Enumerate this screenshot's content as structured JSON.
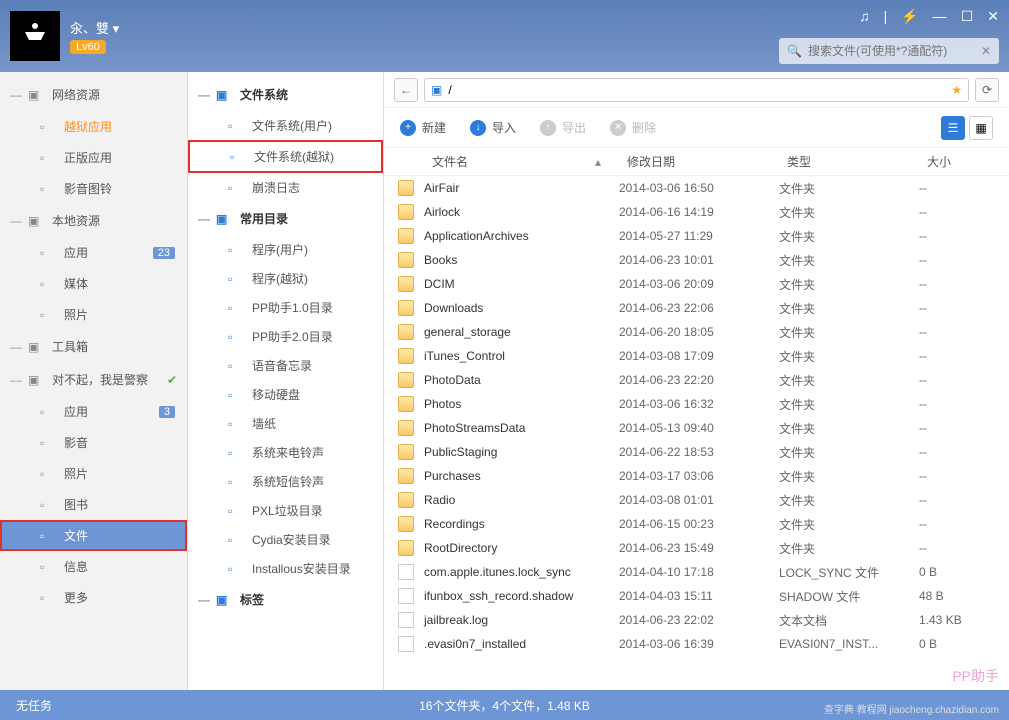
{
  "header": {
    "username": "汆、雙 ▾",
    "level": "Lv60",
    "search_placeholder": "搜索文件(可使用*?通配符)"
  },
  "sidebar_left": {
    "groups": [
      {
        "title": "网络资源",
        "items": [
          {
            "label": "越狱应用",
            "active": true
          },
          {
            "label": "正版应用"
          },
          {
            "label": "影音图铃"
          }
        ]
      },
      {
        "title": "本地资源",
        "items": [
          {
            "label": "应用",
            "badge": "23"
          },
          {
            "label": "媒体"
          },
          {
            "label": "照片"
          }
        ]
      },
      {
        "title": "工具箱",
        "items": []
      },
      {
        "title": "对不起，我是警察",
        "check": true,
        "items": [
          {
            "label": "应用",
            "badge": "3"
          },
          {
            "label": "影音"
          },
          {
            "label": "照片"
          },
          {
            "label": "图书"
          },
          {
            "label": "文件",
            "selected": true,
            "highlighted": true
          },
          {
            "label": "信息"
          },
          {
            "label": "更多"
          }
        ]
      }
    ]
  },
  "sidebar_mid": {
    "groups": [
      {
        "title": "文件系统",
        "items": [
          {
            "label": "文件系统(用户)"
          },
          {
            "label": "文件系统(越狱)",
            "highlighted": true
          },
          {
            "label": "崩溃日志"
          }
        ]
      },
      {
        "title": "常用目录",
        "items": [
          {
            "label": "程序(用户)"
          },
          {
            "label": "程序(越狱)"
          },
          {
            "label": "PP助手1.0目录"
          },
          {
            "label": "PP助手2.0目录"
          },
          {
            "label": "语音备忘录"
          },
          {
            "label": "移动硬盘"
          },
          {
            "label": "墙纸"
          },
          {
            "label": "系统来电铃声"
          },
          {
            "label": "系统短信铃声"
          },
          {
            "label": "PXL垃圾目录"
          },
          {
            "label": "Cydia安装目录"
          },
          {
            "label": "Installous安装目录"
          }
        ]
      },
      {
        "title": "标签",
        "items": []
      }
    ]
  },
  "pathbar": {
    "path": "/"
  },
  "toolbar": {
    "new": "新建",
    "import": "导入",
    "export": "导出",
    "delete": "删除"
  },
  "columns": {
    "name": "文件名",
    "date": "修改日期",
    "type": "类型",
    "size": "大小"
  },
  "files": [
    {
      "name": "AirFair",
      "date": "2014-03-06 16:50",
      "type": "文件夹",
      "size": "--",
      "folder": true
    },
    {
      "name": "Airlock",
      "date": "2014-06-16 14:19",
      "type": "文件夹",
      "size": "--",
      "folder": true
    },
    {
      "name": "ApplicationArchives",
      "date": "2014-05-27 11:29",
      "type": "文件夹",
      "size": "--",
      "folder": true
    },
    {
      "name": "Books",
      "date": "2014-06-23 10:01",
      "type": "文件夹",
      "size": "--",
      "folder": true
    },
    {
      "name": "DCIM",
      "date": "2014-03-06 20:09",
      "type": "文件夹",
      "size": "--",
      "folder": true
    },
    {
      "name": "Downloads",
      "date": "2014-06-23 22:06",
      "type": "文件夹",
      "size": "--",
      "folder": true
    },
    {
      "name": "general_storage",
      "date": "2014-06-20 18:05",
      "type": "文件夹",
      "size": "--",
      "folder": true
    },
    {
      "name": "iTunes_Control",
      "date": "2014-03-08 17:09",
      "type": "文件夹",
      "size": "--",
      "folder": true
    },
    {
      "name": "PhotoData",
      "date": "2014-06-23 22:20",
      "type": "文件夹",
      "size": "--",
      "folder": true
    },
    {
      "name": "Photos",
      "date": "2014-03-06 16:32",
      "type": "文件夹",
      "size": "--",
      "folder": true
    },
    {
      "name": "PhotoStreamsData",
      "date": "2014-05-13 09:40",
      "type": "文件夹",
      "size": "--",
      "folder": true
    },
    {
      "name": "PublicStaging",
      "date": "2014-06-22 18:53",
      "type": "文件夹",
      "size": "--",
      "folder": true
    },
    {
      "name": "Purchases",
      "date": "2014-03-17 03:06",
      "type": "文件夹",
      "size": "--",
      "folder": true
    },
    {
      "name": "Radio",
      "date": "2014-03-08 01:01",
      "type": "文件夹",
      "size": "--",
      "folder": true
    },
    {
      "name": "Recordings",
      "date": "2014-06-15 00:23",
      "type": "文件夹",
      "size": "--",
      "folder": true
    },
    {
      "name": "RootDirectory",
      "date": "2014-06-23 15:49",
      "type": "文件夹",
      "size": "--",
      "folder": true
    },
    {
      "name": "com.apple.itunes.lock_sync",
      "date": "2014-04-10 17:18",
      "type": "LOCK_SYNC 文件",
      "size": "0 B",
      "folder": false
    },
    {
      "name": "ifunbox_ssh_record.shadow",
      "date": "2014-04-03 15:11",
      "type": "SHADOW 文件",
      "size": "48 B",
      "folder": false
    },
    {
      "name": "jailbreak.log",
      "date": "2014-06-23 22:02",
      "type": "文本文档",
      "size": "1.43 KB",
      "folder": false
    },
    {
      "name": ".evasi0n7_installed",
      "date": "2014-03-06 16:39",
      "type": "EVASI0N7_INST...",
      "size": "0 B",
      "folder": false
    }
  ],
  "statusbar": {
    "left": "无任务",
    "center": "16个文件夹，4个文件，1.48 KB"
  },
  "watermark": "PP助手",
  "watermark2": "查字典 教程网 jiaocheng.chazidian.com"
}
